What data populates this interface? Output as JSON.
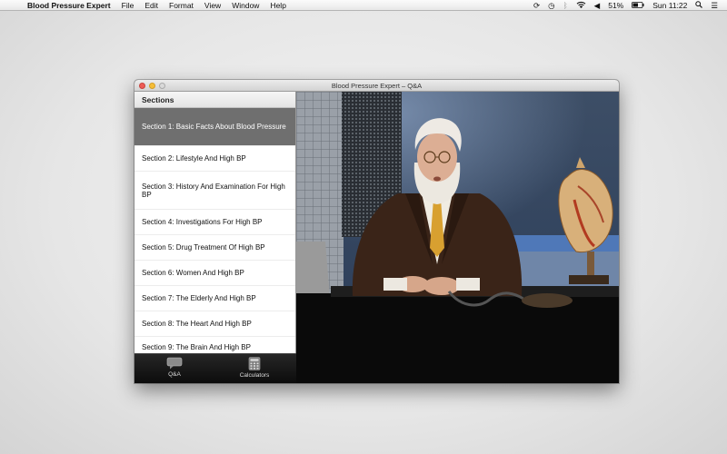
{
  "menubar": {
    "app_name": "Blood Pressure Expert",
    "menus": [
      "File",
      "Edit",
      "Format",
      "View",
      "Window",
      "Help"
    ],
    "battery": "51%",
    "clock": "Sun 11:22"
  },
  "window": {
    "title": "Blood Pressure Expert – Q&A"
  },
  "sidebar": {
    "header": "Sections",
    "items": [
      {
        "label": "Section 1: Basic Facts About Blood Pressure",
        "selected": true
      },
      {
        "label": "Section 2: Lifestyle And High BP",
        "selected": false
      },
      {
        "label": "Section 3: History And Examination For High BP",
        "selected": false
      },
      {
        "label": "Section 4: Investigations For High BP",
        "selected": false
      },
      {
        "label": "Section 5: Drug Treatment Of High BP",
        "selected": false
      },
      {
        "label": "Section 6: Women And High BP",
        "selected": false
      },
      {
        "label": "Section 7: The Elderly And High BP",
        "selected": false
      },
      {
        "label": "Section 8: The Heart And High BP",
        "selected": false
      },
      {
        "label": "Section 9: The Brain And High BP",
        "selected": false
      }
    ]
  },
  "tabbar": {
    "tabs": [
      {
        "label": "Q&A",
        "icon": "speech-bubble-icon"
      },
      {
        "label": "Calculators",
        "icon": "calculator-icon"
      }
    ]
  },
  "video": {
    "content": "presenter-video-frame"
  },
  "colors": {
    "selected_row": "#6f6f6f",
    "tabbar_bg": "#1a1a1a",
    "backdrop_blue": "#3a5a8a"
  }
}
